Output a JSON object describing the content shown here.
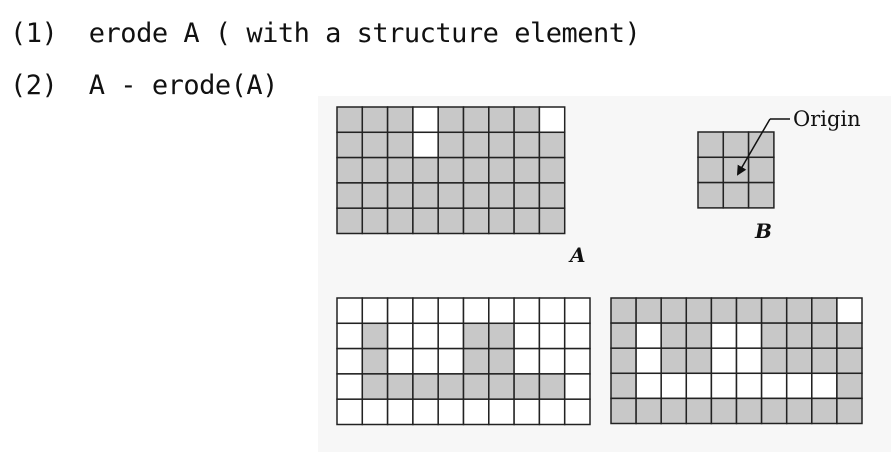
{
  "steps": [
    {
      "num": "(1)",
      "text": "erode A ( with a structure element)"
    },
    {
      "num": "(2)",
      "text": "A - erode(A)"
    }
  ],
  "figure": {
    "label_A": "A",
    "label_B": "B",
    "origin_label": "Origin",
    "colors": {
      "filled": "#c8c8c8",
      "empty": "#ffffff",
      "grid_line": "#222222"
    },
    "grid_A": [
      [
        1,
        1,
        1,
        0,
        1,
        1,
        1,
        1,
        0
      ],
      [
        1,
        1,
        1,
        0,
        1,
        1,
        1,
        1,
        1
      ],
      [
        1,
        1,
        1,
        1,
        1,
        1,
        1,
        1,
        1
      ],
      [
        1,
        1,
        1,
        1,
        1,
        1,
        1,
        1,
        1
      ],
      [
        1,
        1,
        1,
        1,
        1,
        1,
        1,
        1,
        1
      ]
    ],
    "grid_B": [
      [
        1,
        1,
        1
      ],
      [
        1,
        1,
        1
      ],
      [
        1,
        1,
        1
      ]
    ],
    "grid_erosion": [
      [
        0,
        0,
        0,
        0,
        0,
        0,
        0,
        0,
        0,
        0
      ],
      [
        0,
        1,
        0,
        0,
        0,
        1,
        1,
        0,
        0,
        0
      ],
      [
        0,
        1,
        0,
        0,
        0,
        1,
        1,
        0,
        0,
        0
      ],
      [
        0,
        1,
        1,
        1,
        1,
        1,
        1,
        1,
        1,
        0
      ],
      [
        0,
        0,
        0,
        0,
        0,
        0,
        0,
        0,
        0,
        0
      ]
    ],
    "grid_boundary": [
      [
        1,
        1,
        1,
        1,
        1,
        1,
        1,
        1,
        1,
        0
      ],
      [
        1,
        0,
        1,
        1,
        0,
        0,
        1,
        1,
        1,
        1
      ],
      [
        1,
        0,
        1,
        1,
        0,
        0,
        1,
        1,
        1,
        1
      ],
      [
        1,
        0,
        0,
        0,
        0,
        0,
        0,
        0,
        0,
        1
      ],
      [
        1,
        1,
        1,
        1,
        1,
        1,
        1,
        1,
        1,
        1
      ]
    ]
  }
}
